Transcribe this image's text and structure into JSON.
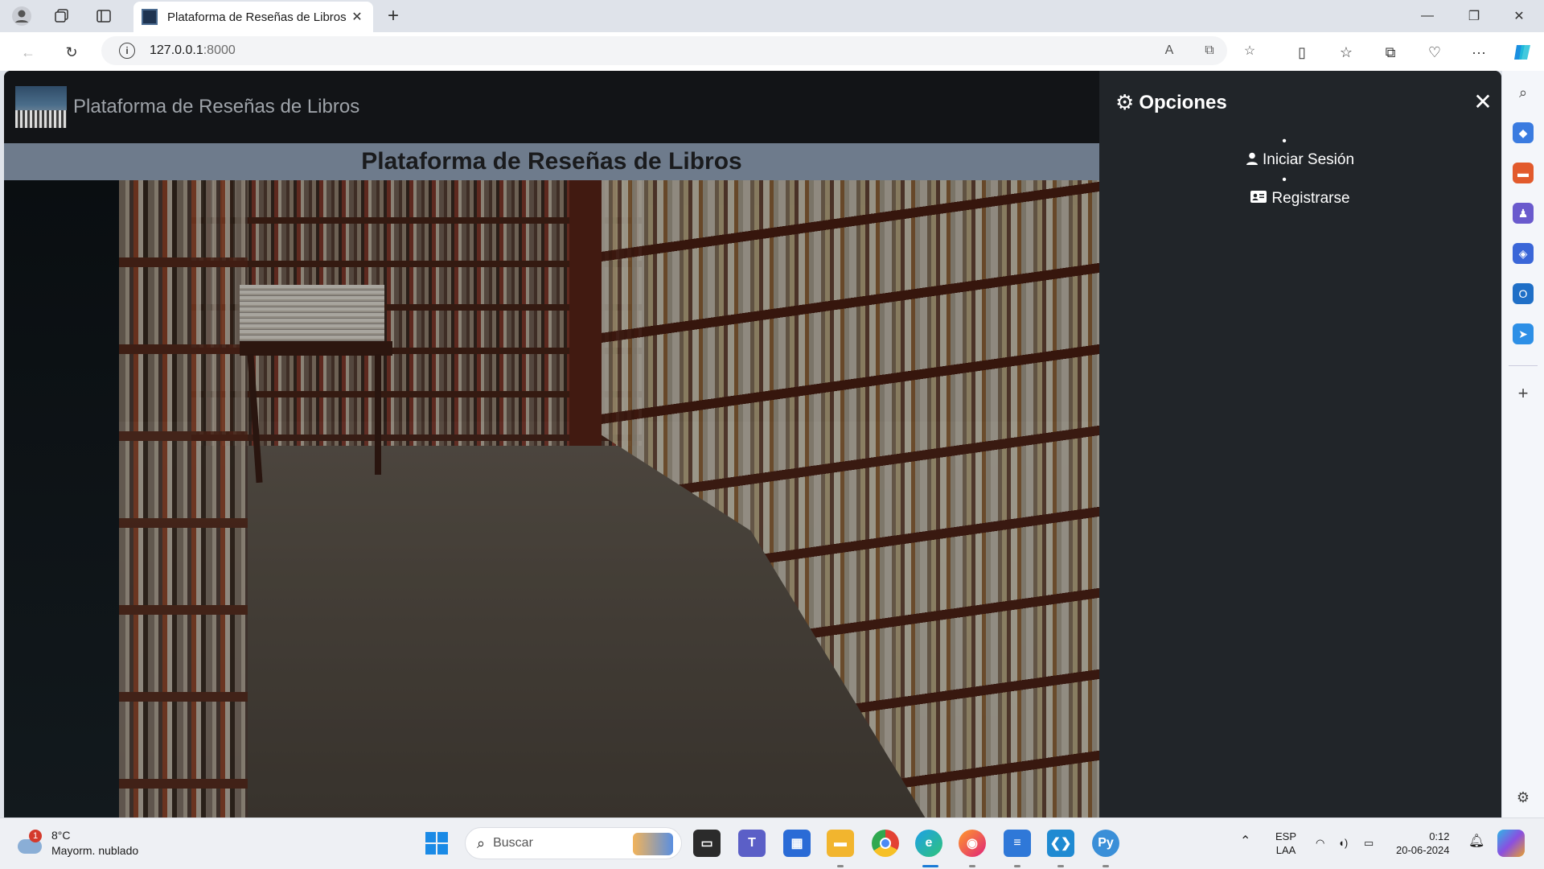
{
  "browser": {
    "tab_title": "Plataforma de Reseñas de Libros",
    "url_host": "127.0.0.1",
    "url_port": ":8000"
  },
  "site": {
    "brand": "Plataforma de Reseñas de Libros",
    "hero_title": "Plataforma de Reseñas de Libros"
  },
  "offcanvas": {
    "title": "Opciones",
    "items": [
      {
        "label": "Iniciar Sesión",
        "icon": "user-icon"
      },
      {
        "label": "Registrarse",
        "icon": "id-card-icon"
      }
    ]
  },
  "taskbar": {
    "weather_temp": "8°C",
    "weather_desc": "Mayorm. nublado",
    "weather_badge": "1",
    "search_placeholder": "Buscar",
    "lang": "ESP",
    "layout": "LAA",
    "time": "0:12",
    "date": "20-06-2024"
  },
  "colors": {
    "offcanvas_bg": "#212529",
    "header_bg": "#121417",
    "hero_bar_bg": "#6e7b8c"
  }
}
